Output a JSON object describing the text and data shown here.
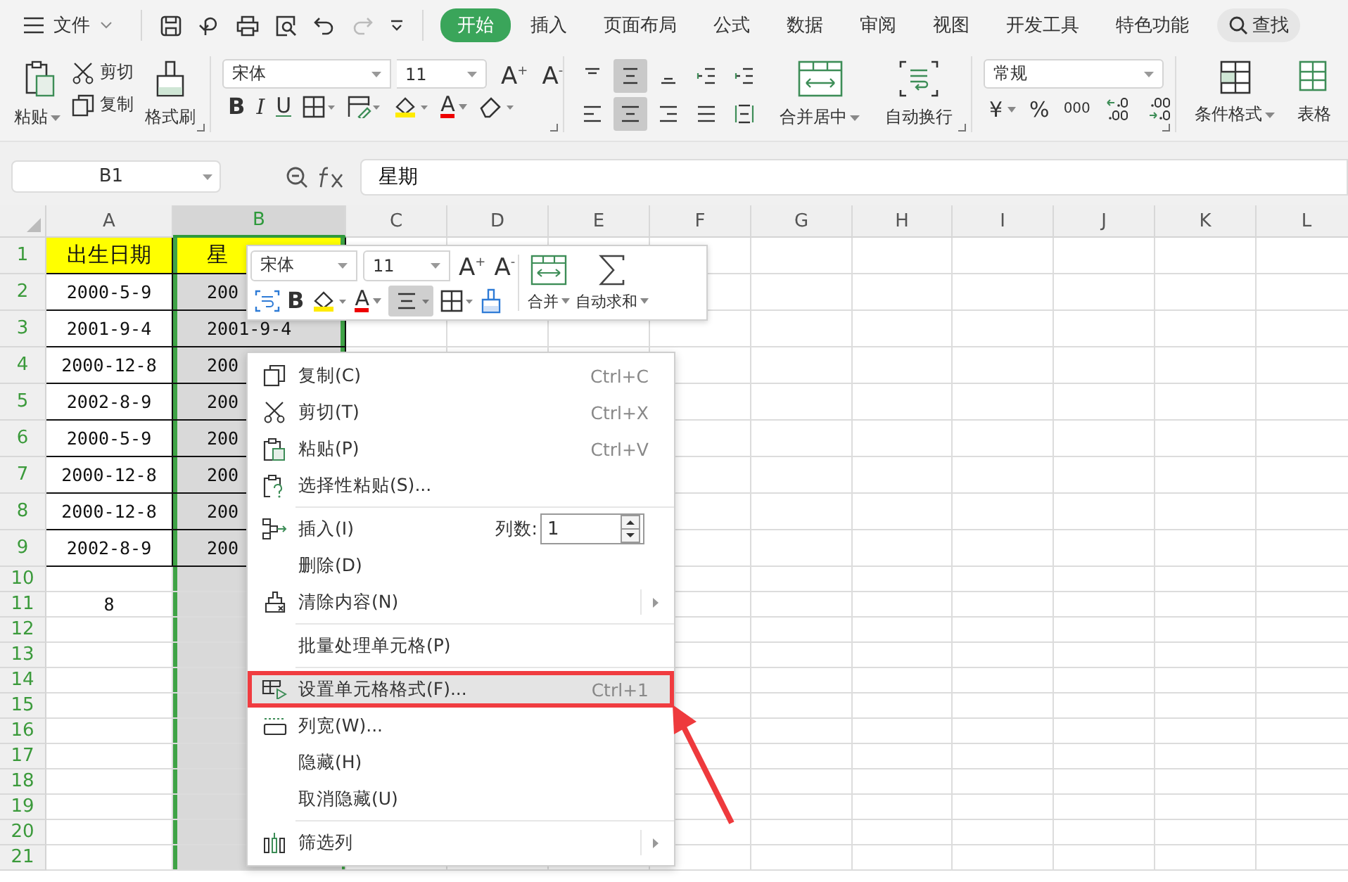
{
  "top_bar": {
    "file_menu": "文件",
    "redo": {
      "disabled": true
    },
    "tabs": [
      {
        "label": "开始",
        "selected": true
      },
      {
        "label": "插入",
        "selected": false
      },
      {
        "label": "页面布局",
        "selected": false
      },
      {
        "label": "公式",
        "selected": false
      },
      {
        "label": "数据",
        "selected": false
      },
      {
        "label": "审阅",
        "selected": false
      },
      {
        "label": "视图",
        "selected": false
      },
      {
        "label": "开发工具",
        "selected": false
      },
      {
        "label": "特色功能",
        "selected": false
      }
    ],
    "search": "查找"
  },
  "ribbon": {
    "paste": "粘贴",
    "cut": "剪切",
    "copy": "复制",
    "format_painter": "格式刷",
    "font_name": "宋体",
    "font_size": "11",
    "grow_font": "A$^{+}$",
    "shrink_font": "A$^{-}$",
    "bold": "B",
    "italic": "I",
    "underline": "U",
    "font_color": "A",
    "align_buttons": [
      {
        "selected": false
      },
      {
        "selected": true
      },
      {
        "selected": false
      },
      {
        "selected": false
      },
      {
        "selected": false
      },
      {
        "selected": false
      },
      {
        "selected": true
      },
      {
        "selected": false
      },
      {
        "selected": false
      },
      {
        "selected": false
      }
    ],
    "merge": "合并居中",
    "wrap": "自动换行",
    "number_format": "常规",
    "currency": "¥",
    "percent": "%",
    "thousands": "000",
    "conditional_format": "条件格式",
    "table_style": "表格"
  },
  "formula_bar": {
    "cell_reference": "B1",
    "content": "星期"
  },
  "sheet": {
    "columns": [
      {
        "label": "A",
        "selected": false
      },
      {
        "label": "B",
        "selected": true
      },
      {
        "label": "C",
        "selected": false
      },
      {
        "label": "D",
        "selected": false
      },
      {
        "label": "E",
        "selected": false
      },
      {
        "label": "F",
        "selected": false
      },
      {
        "label": "G",
        "selected": false
      },
      {
        "label": "H",
        "selected": false
      },
      {
        "label": "I",
        "selected": false
      },
      {
        "label": "J",
        "selected": false
      },
      {
        "label": "K",
        "selected": false
      },
      {
        "label": "L",
        "selected": false
      }
    ],
    "rows": [
      {
        "label": "1",
        "bordered": true,
        "highlighted": true,
        "cells": [
          "出生日期",
          "星"
        ]
      },
      {
        "label": "2",
        "bordered": true,
        "highlighted": false,
        "cells": [
          "2000-5-9",
          "200"
        ]
      },
      {
        "label": "3",
        "bordered": true,
        "highlighted": false,
        "cells": [
          "2001-9-4",
          "2001-9-4"
        ]
      },
      {
        "label": "4",
        "bordered": true,
        "highlighted": false,
        "cells": [
          "2000-12-8",
          "200"
        ]
      },
      {
        "label": "5",
        "bordered": true,
        "highlighted": false,
        "cells": [
          "2002-8-9",
          "200"
        ]
      },
      {
        "label": "6",
        "bordered": true,
        "highlighted": false,
        "cells": [
          "2000-5-9",
          "200"
        ]
      },
      {
        "label": "7",
        "bordered": true,
        "highlighted": false,
        "cells": [
          "2000-12-8",
          "200"
        ]
      },
      {
        "label": "8",
        "bordered": true,
        "highlighted": false,
        "cells": [
          "2000-12-8",
          "200"
        ]
      },
      {
        "label": "9",
        "bordered": true,
        "highlighted": false,
        "cells": [
          "2002-8-9",
          "200"
        ]
      },
      {
        "label": "10"
      },
      {
        "label": "11",
        "bordered": false,
        "highlighted": false,
        "cells": [
          "8"
        ]
      },
      {
        "label": "12"
      },
      {
        "label": "13"
      },
      {
        "label": "14"
      },
      {
        "label": "15"
      },
      {
        "label": "16"
      },
      {
        "label": "17"
      },
      {
        "label": "18"
      },
      {
        "label": "19"
      },
      {
        "label": "20"
      },
      {
        "label": "21"
      }
    ]
  },
  "mini_toolbar": {
    "font_name": "宋体",
    "font_size": "11",
    "grow_font": "A$^{+}$",
    "shrink_font": "A$^{-}$",
    "bold": "B",
    "font_color": "A",
    "align_center": {
      "selected": true
    },
    "merge": "合并",
    "autosum": "自动求和"
  },
  "context_menu": {
    "items": [
      {
        "kind": "item",
        "label": "复制(C)",
        "shortcut": "Ctrl+C",
        "submenu": false,
        "selected": false
      },
      {
        "kind": "item",
        "label": "剪切(T)",
        "shortcut": "Ctrl+X",
        "submenu": false,
        "selected": false
      },
      {
        "kind": "item",
        "label": "粘贴(P)",
        "shortcut": "Ctrl+V",
        "submenu": false,
        "selected": false
      },
      {
        "kind": "item",
        "label": "选择性粘贴(S)...",
        "submenu": false,
        "selected": false
      },
      {
        "kind": "separator"
      },
      {
        "kind": "insert",
        "label": "插入(I)",
        "count_label": "列数:",
        "count_value": "1",
        "submenu": false,
        "selected": false
      },
      {
        "kind": "item",
        "label": "删除(D)",
        "submenu": false,
        "selected": false
      },
      {
        "kind": "item",
        "label": "清除内容(N)",
        "submenu": true,
        "selected": false
      },
      {
        "kind": "separator"
      },
      {
        "kind": "item",
        "label": "批量处理单元格(P)",
        "submenu": false,
        "selected": false
      },
      {
        "kind": "separator"
      },
      {
        "kind": "item",
        "label": "设置单元格格式(F)...",
        "shortcut": "Ctrl+1",
        "submenu": false,
        "selected": true
      },
      {
        "kind": "item",
        "label": "列宽(W)...",
        "submenu": false,
        "selected": false
      },
      {
        "kind": "item",
        "label": "隐藏(H)",
        "submenu": false,
        "selected": false
      },
      {
        "kind": "item",
        "label": "取消隐藏(U)",
        "submenu": false,
        "selected": false
      },
      {
        "kind": "separator"
      },
      {
        "kind": "item",
        "label": "筛选列",
        "submenu": true,
        "selected": false
      }
    ]
  }
}
